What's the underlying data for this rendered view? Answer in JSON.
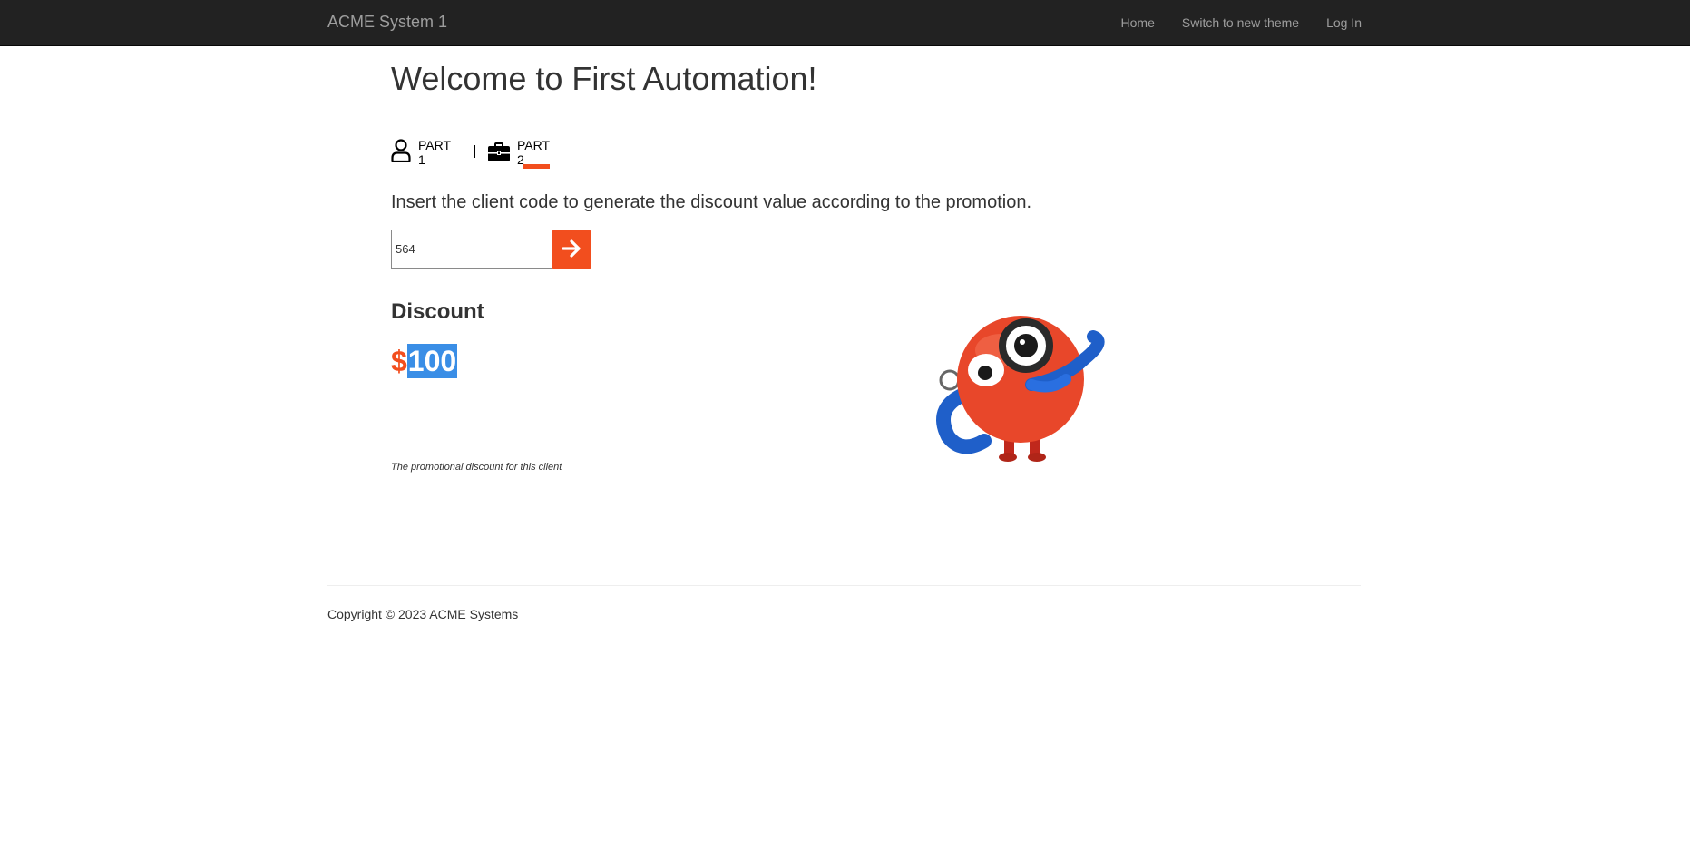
{
  "navbar": {
    "brand": "ACME System 1",
    "links": [
      "Home",
      "Switch to new theme",
      "Log In"
    ],
    "background": "#222222"
  },
  "page": {
    "title": "Welcome to First Automation!",
    "parts": [
      {
        "label": "PART 1",
        "icon": "user-icon"
      },
      {
        "label": "PART 2",
        "icon": "briefcase-icon",
        "active": true
      }
    ],
    "instruction": "Insert the client code to generate the discount value according to the promotion.",
    "client_code": {
      "value": "564",
      "placeholder": ""
    },
    "submit_icon": "arrow-right-icon",
    "discount": {
      "heading": "Discount",
      "currency": "$",
      "amount": "100",
      "caption": "The promotional discount for this client"
    },
    "illustration": "mascot-with-magnifying-glass",
    "accent_color": "#f24e1e",
    "selection_color": "#3a8ee6"
  },
  "footer": {
    "copyright": "Copyright © 2023 ACME Systems"
  }
}
